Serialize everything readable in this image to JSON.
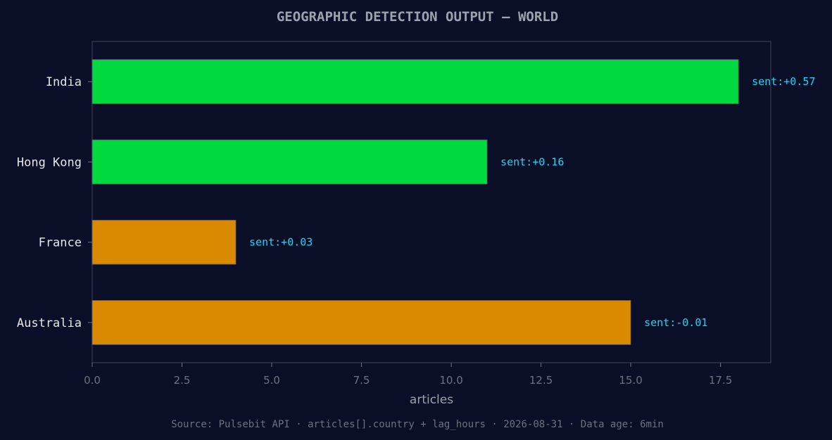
{
  "chart_data": {
    "type": "bar",
    "orientation": "horizontal",
    "title": "GEOGRAPHIC DETECTION OUTPUT — WORLD",
    "xlabel": "articles",
    "ylabel": "",
    "xlim": [
      0,
      18.9
    ],
    "x_ticks": [
      "0.0",
      "2.5",
      "5.0",
      "7.5",
      "10.0",
      "12.5",
      "15.0",
      "17.5"
    ],
    "x_tick_values": [
      0,
      2.5,
      5,
      7.5,
      10,
      12.5,
      15,
      17.5
    ],
    "categories": [
      "India",
      "Hong Kong",
      "France",
      "Australia"
    ],
    "values": [
      18,
      11,
      4,
      15
    ],
    "bar_labels": [
      "sent:+0.57",
      "sent:+0.16",
      "sent:+0.03",
      "sent:-0.01"
    ],
    "bar_colors": [
      "#00d93f",
      "#00d93f",
      "#d98a00",
      "#d98a00"
    ],
    "grid": false,
    "legend": "none"
  },
  "footer": {
    "source": "Source: Pulsebit API · articles[].country + lag_hours · 2026-08-31 · Data age: 6min"
  },
  "colors": {
    "background": "#0a0e27",
    "title": "#9ca3af",
    "label_accent": "#22d3ee",
    "axis": "#2d3250",
    "tick_text": "#6b7280",
    "category_text": "#e5e7eb",
    "positive_bar": "#00d93f",
    "neutral_bar": "#d98a00"
  }
}
